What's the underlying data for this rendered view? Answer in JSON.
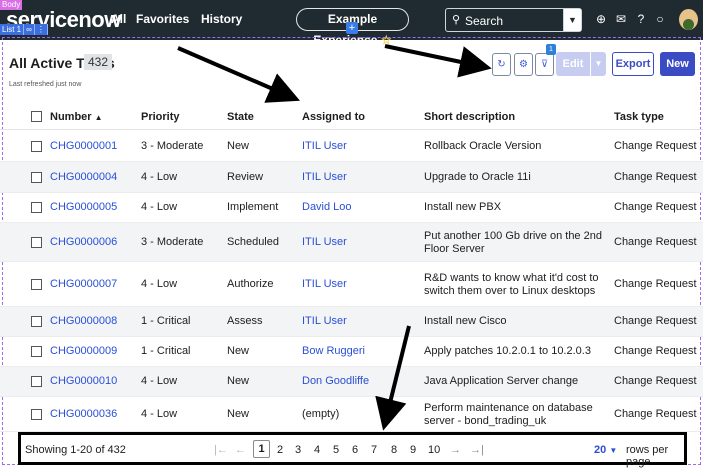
{
  "nav": {
    "brand": "servicenow",
    "links": [
      "All",
      "Favorites",
      "History"
    ],
    "experience": "Example Experience",
    "experience_add": "+",
    "search_label": "Search"
  },
  "inspector": {
    "body_tag": "Body",
    "list_tag": "List 1"
  },
  "header": {
    "title": "All Active Tasks",
    "count": "432",
    "refreshed": "Last refreshed just now",
    "filter_badge": "1",
    "edit_label": "Edit",
    "export_label": "Export",
    "new_label": "New"
  },
  "columns": {
    "number": "Number",
    "priority": "Priority",
    "state": "State",
    "assigned": "Assigned to",
    "short": "Short description",
    "type": "Task type"
  },
  "rows": [
    {
      "number": "CHG0000001",
      "priority": "3 - Moderate",
      "state": "New",
      "assigned": "ITIL User",
      "short": "Rollback Oracle Version",
      "type": "Change Request"
    },
    {
      "number": "CHG0000004",
      "priority": "4 - Low",
      "state": "Review",
      "assigned": "ITIL User",
      "short": "Upgrade to Oracle 11i",
      "type": "Change Request"
    },
    {
      "number": "CHG0000005",
      "priority": "4 - Low",
      "state": "Implement",
      "assigned": "David Loo",
      "short": "Install new PBX",
      "type": "Change Request"
    },
    {
      "number": "CHG0000006",
      "priority": "3 - Moderate",
      "state": "Scheduled",
      "assigned": "ITIL User",
      "short": "Put another 100 Gb drive on the 2nd Floor Server",
      "type": "Change Request"
    },
    {
      "number": "CHG0000007",
      "priority": "4 - Low",
      "state": "Authorize",
      "assigned": "ITIL User",
      "short": "R&D wants to know what it'd cost to switch them over to Linux desktops",
      "type": "Change Request"
    },
    {
      "number": "CHG0000008",
      "priority": "1 - Critical",
      "state": "Assess",
      "assigned": "ITIL User",
      "short": "Install new Cisco",
      "type": "Change Request"
    },
    {
      "number": "CHG0000009",
      "priority": "1 - Critical",
      "state": "New",
      "assigned": "Bow Ruggeri",
      "short": "Apply patches 10.2.0.1 to 10.2.0.3",
      "type": "Change Request"
    },
    {
      "number": "CHG0000010",
      "priority": "4 - Low",
      "state": "New",
      "assigned": "Don Goodliffe",
      "short": "Java Application Server change",
      "type": "Change Request"
    },
    {
      "number": "CHG0000036",
      "priority": "4 - Low",
      "state": "New",
      "assigned": "(empty)",
      "short": "Perform maintenance on database server - bond_trading_uk",
      "type": "Change Request"
    }
  ],
  "pagination": {
    "showing": "Showing 1-20 of 432",
    "pages": [
      "1",
      "2",
      "3",
      "4",
      "5",
      "6",
      "7",
      "8",
      "9",
      "10"
    ],
    "current": "1",
    "rows_value": "20",
    "rows_label": "rows per page"
  },
  "colors": {
    "nav_bg": "#1f2b30",
    "accent": "#3b4bc4",
    "link": "#2a4fd6"
  }
}
